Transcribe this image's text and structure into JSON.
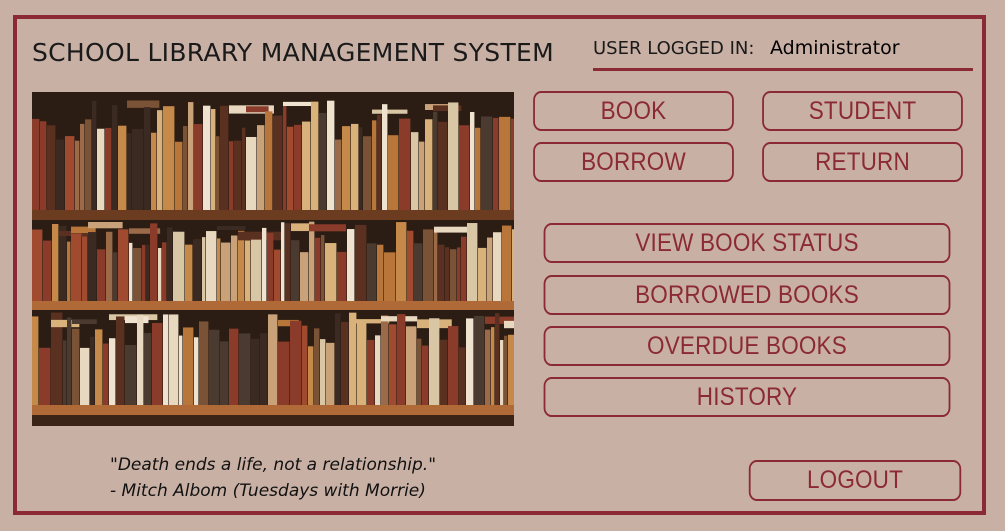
{
  "header": {
    "title": "SCHOOL LIBRARY MANAGEMENT SYSTEM",
    "user_label": "USER LOGGED IN:",
    "user_value": "Administrator"
  },
  "buttons": {
    "book": "BOOK",
    "student": "STUDENT",
    "borrow": "BORROW",
    "return": "RETURN",
    "view_book_status": "VIEW BOOK STATUS",
    "borrowed_books": "BORROWED BOOKS",
    "overdue_books": "OVERDUE BOOKS",
    "history": "HISTORY",
    "logout": "LOGOUT"
  },
  "quote": {
    "text": "\"Death ends a life, not a relationship.\"",
    "attribution": "- Mitch Albom (Tuesdays with Morrie)"
  },
  "colors": {
    "accent": "#8b2a34",
    "background": "#c9b0a4"
  }
}
